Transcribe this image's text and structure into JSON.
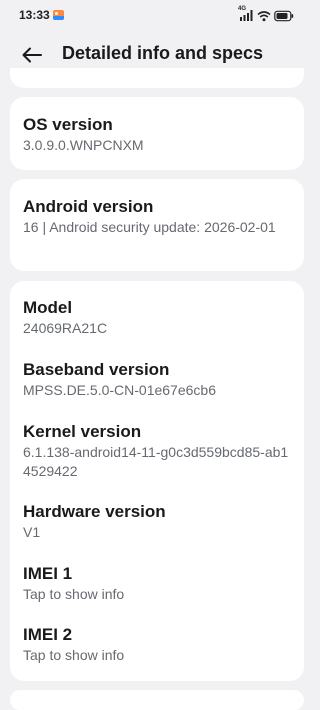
{
  "status_bar": {
    "time": "13:33",
    "network_type": "4G"
  },
  "header": {
    "title": "Detailed info and specs"
  },
  "cards": {
    "os": {
      "title": "OS version",
      "value": "3.0.9.0.WNPCNXM"
    },
    "android": {
      "title": "Android version",
      "value": "16 | Android security update: 2026-02-01"
    },
    "device": {
      "model_title": "Model",
      "model_value": "24069RA21C",
      "baseband_title": "Baseband version",
      "baseband_value": "MPSS.DE.5.0-CN-01e67e6cb6",
      "kernel_title": "Kernel version",
      "kernel_value": "6.1.138-android14-11-g0c3d559bcd85-ab14529422",
      "hardware_title": "Hardware version",
      "hardware_value": "V1",
      "imei1_title": "IMEI 1",
      "imei1_value": "Tap to show info",
      "imei2_title": "IMEI 2",
      "imei2_value": "Tap to show info"
    }
  },
  "icons": {
    "back": "arrow-left-icon",
    "gallery": "gallery-notification-icon",
    "signal": "signal-icon",
    "wifi": "wifi-icon",
    "battery": "battery-icon"
  }
}
